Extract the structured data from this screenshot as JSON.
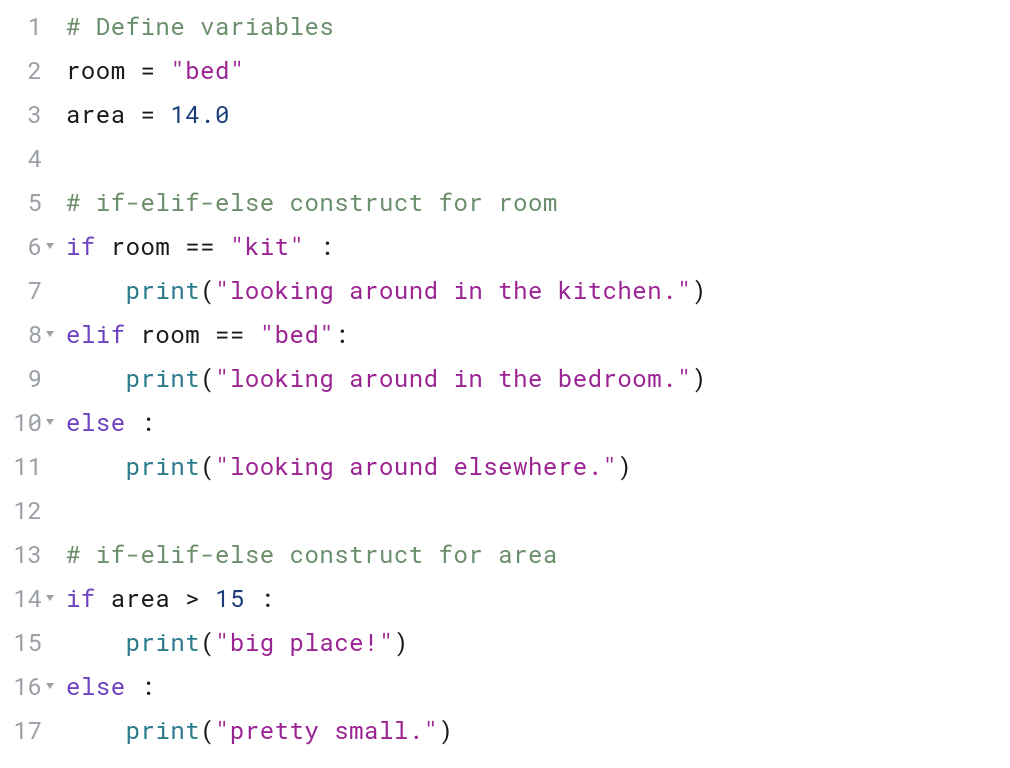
{
  "editor": {
    "lines": [
      {
        "num": "1",
        "fold": false,
        "tokens": [
          {
            "cls": "tk-comment",
            "text": "# Define variables"
          }
        ]
      },
      {
        "num": "2",
        "fold": false,
        "tokens": [
          {
            "cls": "tk-default",
            "text": "room"
          },
          {
            "cls": "tk-operator",
            "text": " = "
          },
          {
            "cls": "tk-string",
            "text": "\"bed\""
          }
        ]
      },
      {
        "num": "3",
        "fold": false,
        "tokens": [
          {
            "cls": "tk-default",
            "text": "area"
          },
          {
            "cls": "tk-operator",
            "text": " = "
          },
          {
            "cls": "tk-number",
            "text": "14.0"
          }
        ]
      },
      {
        "num": "4",
        "fold": false,
        "tokens": []
      },
      {
        "num": "5",
        "fold": false,
        "tokens": [
          {
            "cls": "tk-comment",
            "text": "# if-elif-else construct for room"
          }
        ]
      },
      {
        "num": "6",
        "fold": true,
        "tokens": [
          {
            "cls": "tk-keyword",
            "text": "if"
          },
          {
            "cls": "tk-default",
            "text": " room "
          },
          {
            "cls": "tk-operator",
            "text": "=="
          },
          {
            "cls": "tk-default",
            "text": " "
          },
          {
            "cls": "tk-string",
            "text": "\"kit\""
          },
          {
            "cls": "tk-default",
            "text": " "
          },
          {
            "cls": "tk-punct",
            "text": ":"
          }
        ]
      },
      {
        "num": "7",
        "fold": false,
        "tokens": [
          {
            "cls": "tk-default",
            "text": "    "
          },
          {
            "cls": "tk-builtin",
            "text": "print"
          },
          {
            "cls": "tk-punct",
            "text": "("
          },
          {
            "cls": "tk-string",
            "text": "\"looking around in the kitchen.\""
          },
          {
            "cls": "tk-punct",
            "text": ")"
          }
        ]
      },
      {
        "num": "8",
        "fold": true,
        "tokens": [
          {
            "cls": "tk-keyword",
            "text": "elif"
          },
          {
            "cls": "tk-default",
            "text": " room "
          },
          {
            "cls": "tk-operator",
            "text": "=="
          },
          {
            "cls": "tk-default",
            "text": " "
          },
          {
            "cls": "tk-string",
            "text": "\"bed\""
          },
          {
            "cls": "tk-punct",
            "text": ":"
          }
        ]
      },
      {
        "num": "9",
        "fold": false,
        "tokens": [
          {
            "cls": "tk-default",
            "text": "    "
          },
          {
            "cls": "tk-builtin",
            "text": "print"
          },
          {
            "cls": "tk-punct",
            "text": "("
          },
          {
            "cls": "tk-string",
            "text": "\"looking around in the bedroom.\""
          },
          {
            "cls": "tk-punct",
            "text": ")"
          }
        ]
      },
      {
        "num": "10",
        "fold": true,
        "tokens": [
          {
            "cls": "tk-keyword",
            "text": "else"
          },
          {
            "cls": "tk-default",
            "text": " "
          },
          {
            "cls": "tk-punct",
            "text": ":"
          }
        ]
      },
      {
        "num": "11",
        "fold": false,
        "tokens": [
          {
            "cls": "tk-default",
            "text": "    "
          },
          {
            "cls": "tk-builtin",
            "text": "print"
          },
          {
            "cls": "tk-punct",
            "text": "("
          },
          {
            "cls": "tk-string",
            "text": "\"looking around elsewhere.\""
          },
          {
            "cls": "tk-punct",
            "text": ")"
          }
        ]
      },
      {
        "num": "12",
        "fold": false,
        "tokens": []
      },
      {
        "num": "13",
        "fold": false,
        "tokens": [
          {
            "cls": "tk-comment",
            "text": "# if-elif-else construct for area"
          }
        ]
      },
      {
        "num": "14",
        "fold": true,
        "tokens": [
          {
            "cls": "tk-keyword",
            "text": "if"
          },
          {
            "cls": "tk-default",
            "text": " area "
          },
          {
            "cls": "tk-operator",
            "text": ">"
          },
          {
            "cls": "tk-default",
            "text": " "
          },
          {
            "cls": "tk-number",
            "text": "15"
          },
          {
            "cls": "tk-default",
            "text": " "
          },
          {
            "cls": "tk-punct",
            "text": ":"
          }
        ]
      },
      {
        "num": "15",
        "fold": false,
        "tokens": [
          {
            "cls": "tk-default",
            "text": "    "
          },
          {
            "cls": "tk-builtin",
            "text": "print"
          },
          {
            "cls": "tk-punct",
            "text": "("
          },
          {
            "cls": "tk-string",
            "text": "\"big place!\""
          },
          {
            "cls": "tk-punct",
            "text": ")"
          }
        ]
      },
      {
        "num": "16",
        "fold": true,
        "tokens": [
          {
            "cls": "tk-keyword",
            "text": "else"
          },
          {
            "cls": "tk-default",
            "text": " "
          },
          {
            "cls": "tk-punct",
            "text": ":"
          }
        ]
      },
      {
        "num": "17",
        "fold": false,
        "tokens": [
          {
            "cls": "tk-default",
            "text": "    "
          },
          {
            "cls": "tk-builtin",
            "text": "print"
          },
          {
            "cls": "tk-punct",
            "text": "("
          },
          {
            "cls": "tk-string",
            "text": "\"pretty small.\""
          },
          {
            "cls": "tk-punct",
            "text": ")"
          }
        ]
      }
    ]
  }
}
